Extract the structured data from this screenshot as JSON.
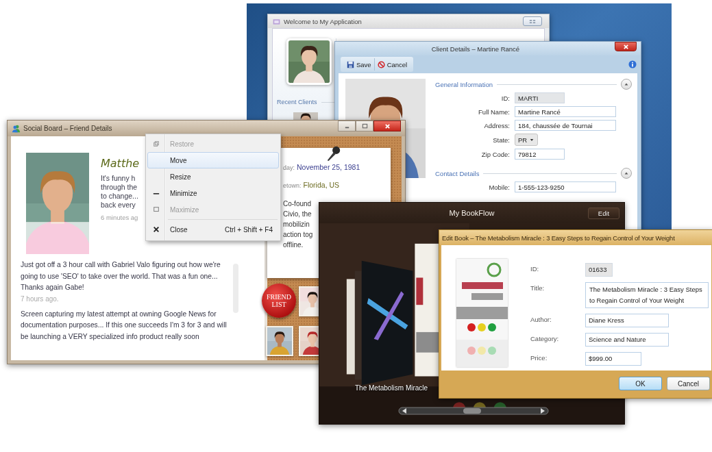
{
  "welcome_window": {
    "title": "Welcome to My Application",
    "section": "Recent Clients"
  },
  "client_window": {
    "title": "Client Details – Martine Rancé",
    "toolbar": [
      {
        "label": "Save",
        "kind": "save"
      },
      {
        "label": "Cancel",
        "kind": "cancel"
      }
    ],
    "sections": [
      {
        "title": "General Information",
        "expanded": true,
        "fields": [
          {
            "label": "ID:",
            "value": "MARTI",
            "kind": "readonly"
          },
          {
            "label": "Full Name:",
            "value": "Martine Rancé",
            "kind": "text"
          },
          {
            "label": "Address:",
            "value": "184, chaussée de Tournai",
            "kind": "text"
          },
          {
            "label": "State:",
            "value": "PR",
            "kind": "dropdown"
          },
          {
            "label": "Zip Code:",
            "value": "79812",
            "kind": "short"
          }
        ]
      },
      {
        "title": "Contact Details",
        "expanded": true,
        "fields": [
          {
            "label": "Mobile:",
            "value": "1-555-123-9250",
            "kind": "text"
          }
        ]
      }
    ]
  },
  "social_window": {
    "title": "Social Board – Friend Details",
    "name": "Matthe",
    "status_lines": [
      "It's funny h",
      "through the",
      "to change...",
      "back every"
    ],
    "status_time": "6 minutes ag",
    "posts": [
      {
        "text": "Just got off a 3 hour call with Gabriel Valo figuring out how we're going to use 'SEO' to take over the world. That was a fun one... Thanks again Gabe!",
        "time": "7 hours ago."
      },
      {
        "text": " Screen capturing my latest attempt at owning Google News for documentation purposes... If this one succeeds I'm 3 for 3 and will be launching a VERY specialized info product really soon"
      }
    ],
    "details": [
      {
        "label": "day:",
        "value": "November 25, 1981",
        "color": "#3b3f8f"
      },
      {
        "label": "etown:",
        "value": "Florida, US",
        "color": "#6b6a1f"
      }
    ],
    "bio_lines": [
      "Co-found",
      "Civio, the",
      "mobilizin",
      "action tog",
      "offline."
    ],
    "friend_badge": "FRIEND LIST"
  },
  "context_menu": {
    "items": [
      {
        "label": "Restore",
        "kind": "restore",
        "disabled": true,
        "selected": false
      },
      {
        "label": "Move",
        "kind": "plain",
        "disabled": false,
        "selected": true
      },
      {
        "label": "Resize",
        "kind": "plain",
        "disabled": false,
        "selected": false
      },
      {
        "label": "Minimize",
        "kind": "minimize",
        "disabled": false,
        "selected": false
      },
      {
        "label": "Maximize",
        "kind": "maximize",
        "disabled": true,
        "selected": false
      },
      {
        "label": "Close",
        "kind": "close",
        "shortcut": "Ctrl + Shift + F4",
        "separator_before": true,
        "disabled": false,
        "selected": false
      }
    ]
  },
  "bookflow_window": {
    "title": "My BookFlow",
    "edit_button": "Edit",
    "caption": "The Metabolism Miracle"
  },
  "edit_dialog": {
    "title": "Edit Book – The Metabolism Miracle : 3 Easy Steps to Regain Control of Your Weight",
    "fields": [
      {
        "label": "ID:",
        "value": "01633",
        "kind": "readonly"
      },
      {
        "label": "Title:",
        "value": "The Metabolism Miracle : 3 Easy Steps to Regain Control of Your Weight",
        "kind": "multiline"
      },
      {
        "label": "Author:",
        "value": "Diane Kress",
        "kind": "text"
      },
      {
        "label": "Category:",
        "value": "Science and Nature",
        "kind": "text"
      },
      {
        "label": "Price:",
        "value": "$999.00",
        "kind": "short"
      }
    ],
    "buttons": [
      {
        "label": "OK",
        "default": true
      },
      {
        "label": "Cancel",
        "default": false
      }
    ]
  }
}
